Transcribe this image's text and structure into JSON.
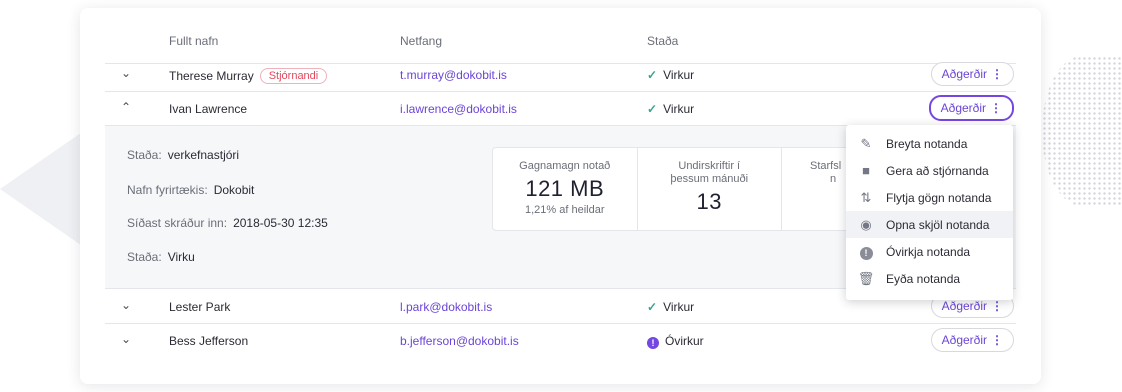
{
  "header": {
    "name": "Fullt nafn",
    "email": "Netfang",
    "status": "Staða"
  },
  "actions_label": "Aðgerðir",
  "users": [
    {
      "name": "Therese Murray",
      "badge": "Stjórnandi",
      "email": "t.murray@dokobit.is",
      "status": "Virkur",
      "status_type": "active",
      "expanded": false
    },
    {
      "name": "Ivan Lawrence",
      "badge": "",
      "email": "i.lawrence@dokobit.is",
      "status": "Virkur",
      "status_type": "active",
      "expanded": true
    },
    {
      "name": "Lester Park",
      "badge": "",
      "email": "l.park@dokobit.is",
      "status": "Virkur",
      "status_type": "active",
      "expanded": false
    },
    {
      "name": "Bess Jefferson",
      "badge": "",
      "email": "b.jefferson@dokobit.is",
      "status": "Óvirkur",
      "status_type": "inactive",
      "expanded": false
    }
  ],
  "detail": {
    "role_label": "Staða:",
    "role_value": "verkefnastjóri",
    "company_label": "Nafn fyrirtækis:",
    "company_value": "Dokobit",
    "last_login_label": "Síðast skráður inn:",
    "last_login_value": "2018-05-30 12:35",
    "state_label": "Staða:",
    "state_value": "Virku",
    "stats": [
      {
        "label": "Gagnamagn notað",
        "value": "121 MB",
        "sub": "1,21% af heildar"
      },
      {
        "label": "Undirskriftir í þessum mánuði",
        "value": "13",
        "sub": ""
      },
      {
        "label": "Starfsl",
        "label2": "n"
      }
    ]
  },
  "menu": {
    "items": [
      {
        "label": "Breyta notanda",
        "icon": "pencil-icon"
      },
      {
        "label": "Gera að stjórnanda",
        "icon": "admin-badge-icon"
      },
      {
        "label": "Flytja gögn notanda",
        "icon": "transfer-arrows-icon"
      },
      {
        "label": "Opna skjöl notanda",
        "icon": "globe-icon",
        "hovered": true
      },
      {
        "label": "Óvirkja notanda",
        "icon": "exclamation-circle-icon"
      },
      {
        "label": "Eyða notanda",
        "icon": "trash-icon"
      }
    ]
  },
  "colors": {
    "accent": "#7547e0",
    "link": "#6b45d6",
    "success": "#3aa58a",
    "admin_badge": "#e0485d"
  }
}
